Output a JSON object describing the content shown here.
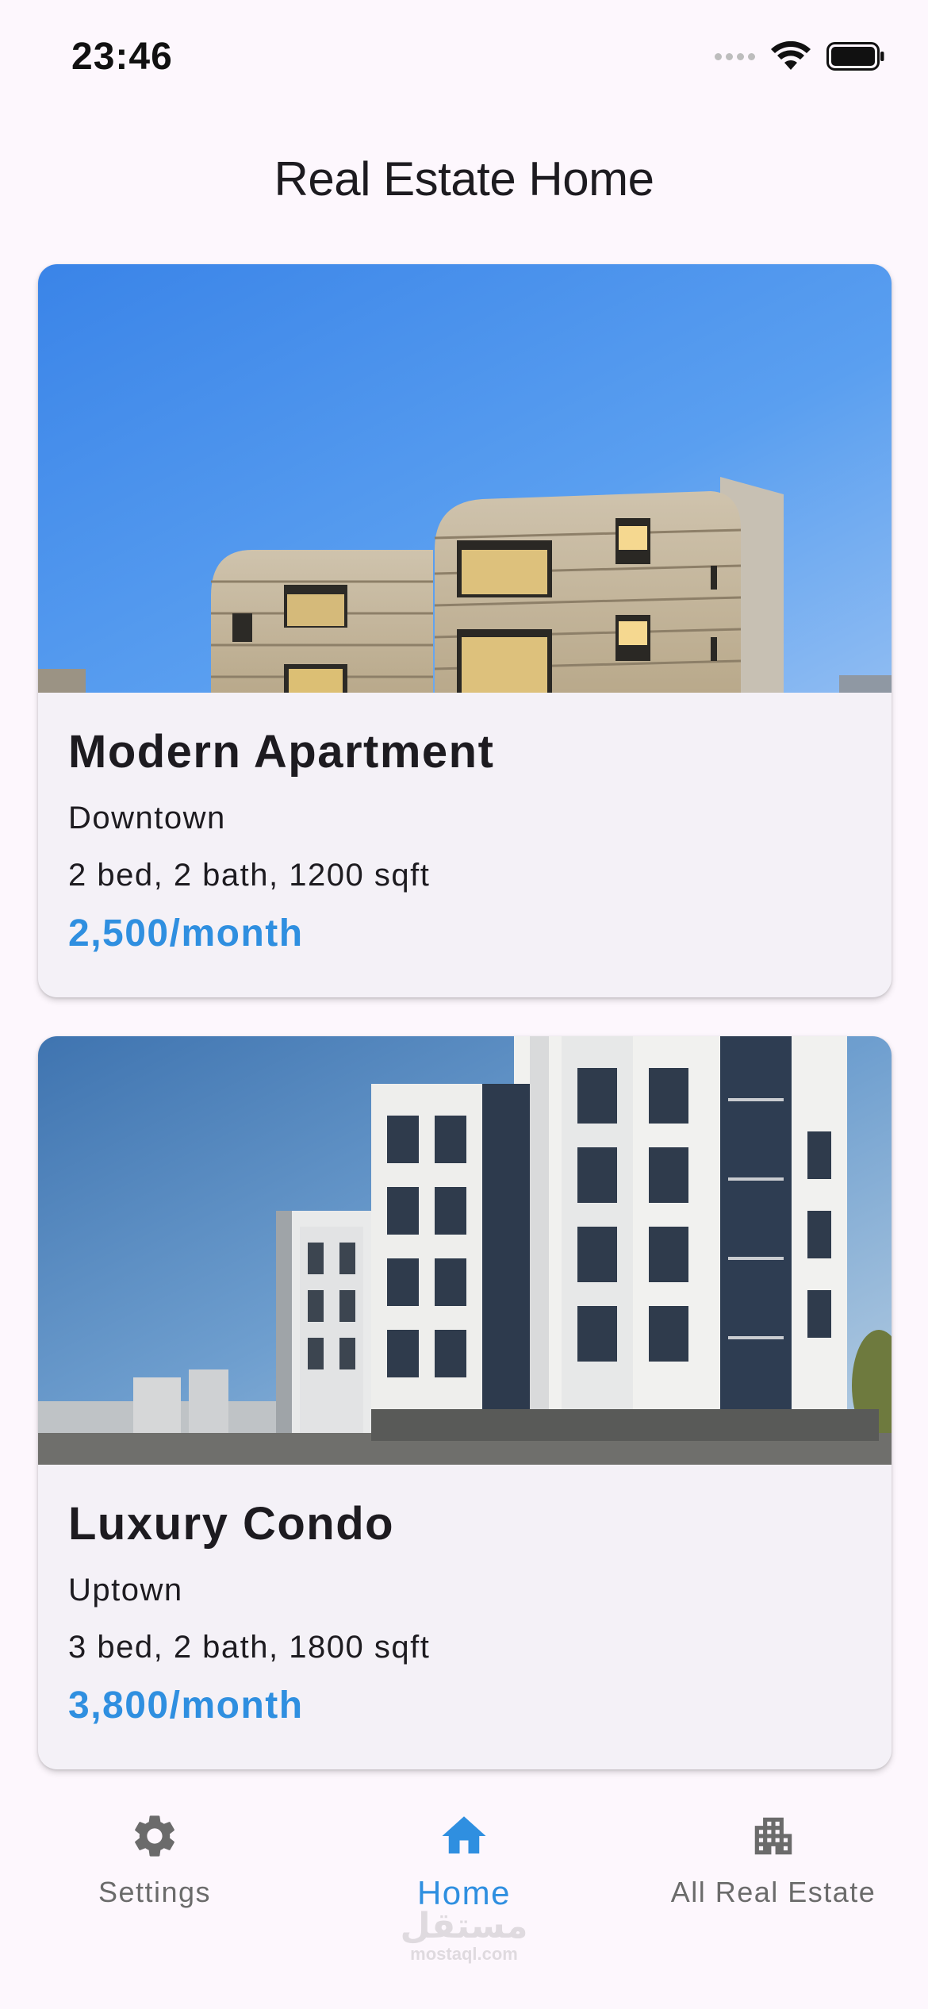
{
  "status_bar": {
    "time": "23:46"
  },
  "app_bar": {
    "title": "Real Estate Home"
  },
  "listings": [
    {
      "title": "Modern Apartment",
      "location": "Downtown",
      "details": "2 bed, 2 bath, 1200 sqft",
      "price": "2,500/month"
    },
    {
      "title": "Luxury Condo",
      "location": "Uptown",
      "details": "3 bed, 2 bath, 1800 sqft",
      "price": "3,800/month"
    }
  ],
  "bottom_nav": {
    "items": [
      {
        "label": "Settings",
        "icon": "gear-icon",
        "active": false
      },
      {
        "label": "Home",
        "icon": "home-icon",
        "active": true
      },
      {
        "label": "All Real Estate",
        "icon": "apartment-building-icon",
        "active": false
      }
    ]
  },
  "watermark": {
    "arabic": "مستقل",
    "latin": "mostaql.com"
  },
  "colors": {
    "accent": "#2f8fe0",
    "background": "#fdf7fd",
    "card": "#f4f1f7",
    "text": "#1d1b20"
  }
}
